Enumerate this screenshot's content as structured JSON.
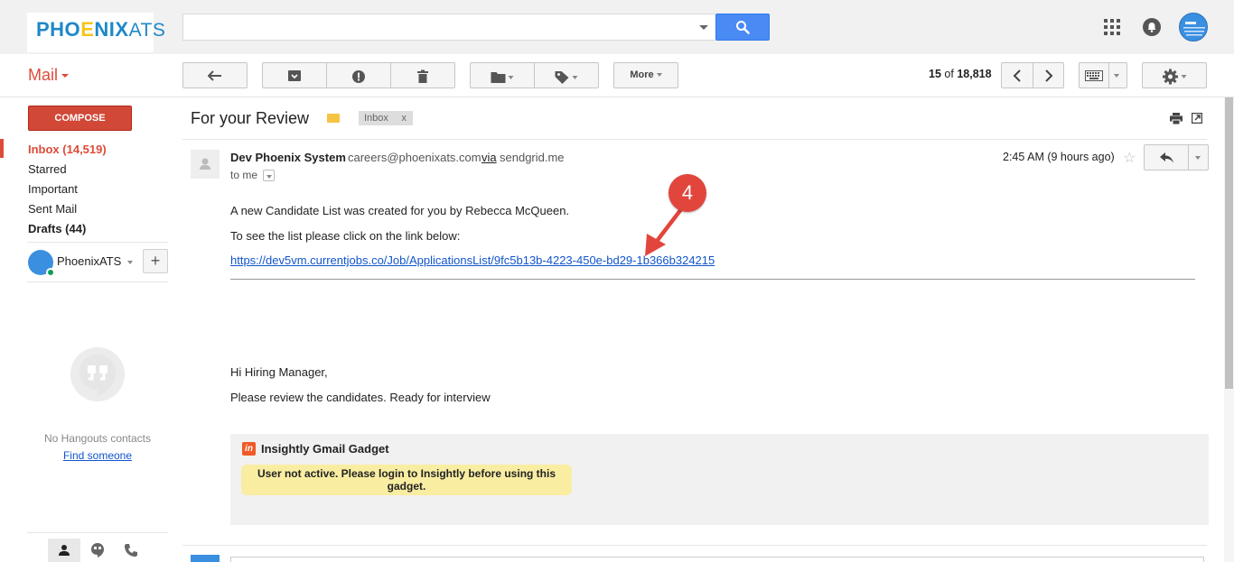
{
  "brand": {
    "logo_part1": "PHO",
    "logo_e": "E",
    "logo_part2": "NIX",
    "logo_part3": "ATS",
    "accent": "#dd4b39",
    "link": "#1155cc"
  },
  "search": {
    "placeholder": "",
    "button_icon": "search-icon"
  },
  "header": {
    "mail_label": "Mail"
  },
  "toolbar": {
    "more_label": "More",
    "page_range_start": "15",
    "page_of": "of",
    "page_total": "18,818"
  },
  "sidebar": {
    "compose_label": "COMPOSE",
    "items": [
      {
        "label": "Inbox (14,519)"
      },
      {
        "label": "Starred"
      },
      {
        "label": "Important"
      },
      {
        "label": "Sent Mail"
      },
      {
        "label": "Drafts (44)"
      }
    ],
    "account_name": "PhoenixATS",
    "no_contacts": "No Hangouts contacts",
    "find_someone": "Find someone"
  },
  "message": {
    "subject": "For your Review",
    "label_chip": "Inbox",
    "label_chip_close": "x",
    "sender_name": "Dev Phoenix System",
    "sender_email": "careers@phoenixats.com",
    "via": "via",
    "via_domain": "sendgrid.me",
    "to": "to me",
    "time": "2:45 AM (9 hours ago)",
    "body_lines": [
      "A new Candidate List was created for you by Rebecca McQueen.",
      "To see the list please click on the link below:"
    ],
    "link": "https://dev5vm.currentjobs.co/Job/ApplicationsList/9fc5b13b-4223-450e-bd29-1b366b324215",
    "greeting": "Hi Hiring Manager,",
    "review_line": "Please review the candidates. Ready for interview"
  },
  "gadget": {
    "logo_text": "in",
    "title": "Insightly Gmail Gadget",
    "warning": "User not active. Please login to Insightly before using this gadget."
  },
  "annotation": {
    "number": "4",
    "color": "#e2453c"
  }
}
